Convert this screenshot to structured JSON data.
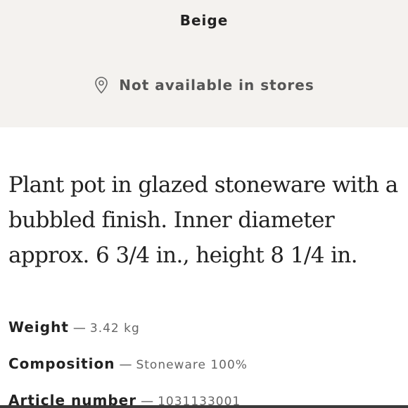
{
  "product": {
    "color_name": "Beige",
    "store_availability": "Not available in stores",
    "description": "Plant pot in glazed stoneware with a bubbled finish. Inner diameter approx. 6 3/4 in., height 8 1/4 in."
  },
  "specs": {
    "dash": "—",
    "weight": {
      "label": "Weight",
      "value": "3.42 kg"
    },
    "composition": {
      "label": "Composition",
      "value": "Stoneware 100%"
    },
    "article_number": {
      "label": "Article number",
      "value": "1031133001"
    }
  },
  "icons": {
    "store": "location-pin-icon"
  }
}
